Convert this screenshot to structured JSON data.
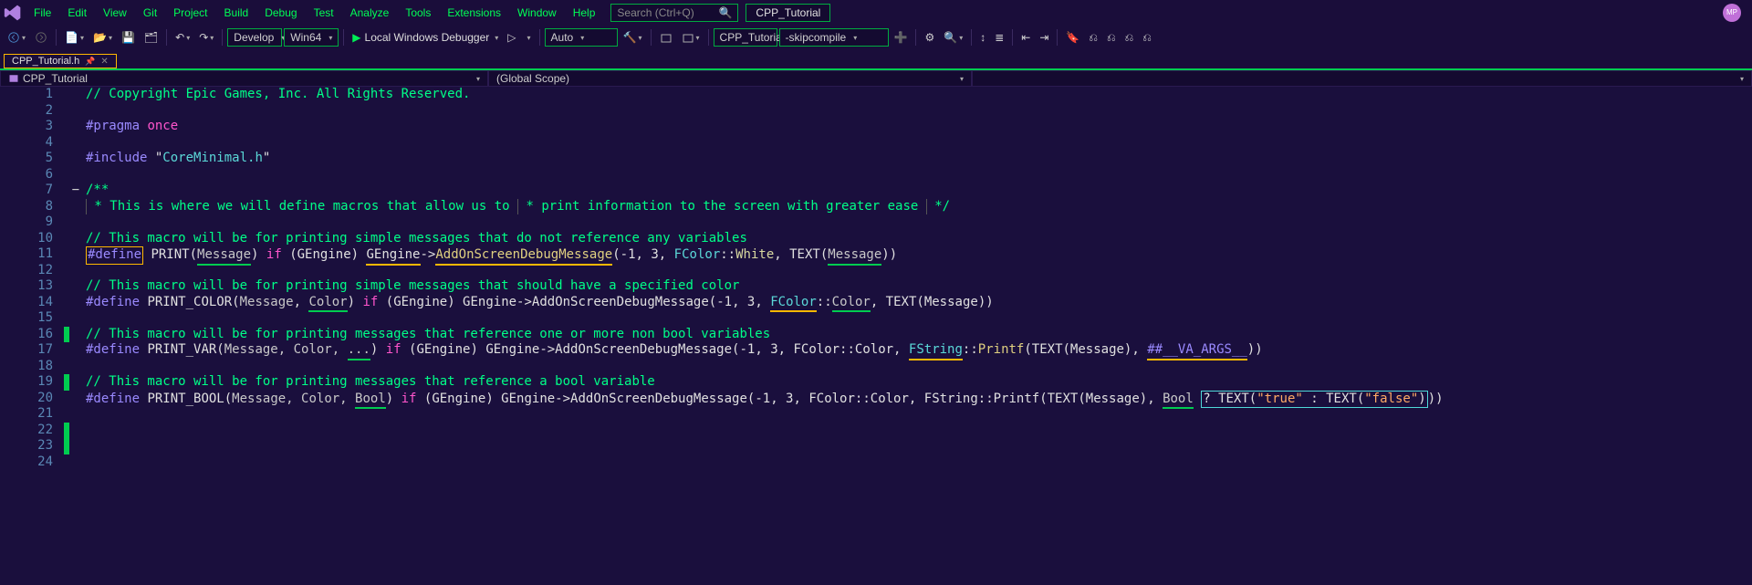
{
  "menu": {
    "items": [
      "File",
      "Edit",
      "View",
      "Git",
      "Project",
      "Build",
      "Debug",
      "Test",
      "Analyze",
      "Tools",
      "Extensions",
      "Window",
      "Help"
    ]
  },
  "search": {
    "placeholder": "Search (Ctrl+Q)"
  },
  "title": "CPP_Tutorial",
  "avatar": "MP",
  "toolbar": {
    "config": "Develop",
    "platform": "Win64",
    "debugger_label": "Local Windows Debugger",
    "run_mode": "Auto",
    "solution": "CPP_Tutorial",
    "skip": "-skipcompile"
  },
  "file_tab": {
    "name": "CPP_Tutorial.h"
  },
  "nav": {
    "project": "CPP_Tutorial",
    "scope": "(Global Scope)"
  },
  "code": {
    "l1_a": "// Copyright Epic Games, Inc. All Rights Reserved.",
    "l3_a": "#pragma",
    "l3_b": " once",
    "l5_a": "#include",
    "l5_b": " \"",
    "l5_c": "CoreMinimal.h",
    "l5_d": "\"",
    "l7_a": "/**",
    "l8_a": " * This is where we will define macros that allow us to",
    "l9_a": " * print information to the screen with greater ease",
    "l10_a": " */",
    "l12_a": "// This macro will be for printing simple messages that do not reference any variables",
    "l13_def": "#define",
    "l13_name": " PRINT(",
    "l13_msg": "Message",
    "l13_a": ") ",
    "l13_if": "if",
    "l13_b": " (GEngine) ",
    "l13_ge": "GEngine",
    "l13_arrow": "->",
    "l13_add": "AddOnScreenDebugMessage",
    "l13_c": "(-1, 3, ",
    "l13_fc": "FColor",
    "l13_cc": "::",
    "l13_wh": "White",
    "l13_d": ", TEXT(",
    "l13_msg2": "Message",
    "l13_e": "))",
    "l15_a": "// This macro will be for printing simple messages that should have a specified color",
    "l16_def": "#define",
    "l16_name": " PRINT_COLOR(",
    "l16_p1": "Message",
    "l16_s1": ", ",
    "l16_p2": "Color",
    "l16_a": ") ",
    "l16_if": "if",
    "l16_b": " (GEngine) GEngine->AddOnScreenDebugMessage(-1, 3, ",
    "l16_fc": "FColor",
    "l16_cc": "::",
    "l16_col": "Color",
    "l16_c": ", TEXT(Message))",
    "l18_a": "// This macro will be for printing messages that reference one or more non bool variables",
    "l19_def": "#define",
    "l19_name": " PRINT_VAR(",
    "l19_p": "Message, Color, ",
    "l19_dots": "...",
    "l19_a": ") ",
    "l19_if": "if",
    "l19_b": " (GEngine) GEngine->AddOnScreenDebugMessage(-1, 3, FColor::Color, ",
    "l19_fs": "FString",
    "l19_cc": "::",
    "l19_pf": "Printf",
    "l19_c": "(TEXT(Message), ",
    "l19_va": "##__VA_ARGS__",
    "l19_d": "))",
    "l21_a": "// This macro will be for printing messages that reference a bool variable",
    "l22_def": "#define",
    "l22_name": " PRINT_BOOL(",
    "l22_p": "Message, Color, ",
    "l22_bool": "Bool",
    "l22_a": ") ",
    "l22_if": "if",
    "l22_b": " (GEngine) GEngine->AddOnScreenDebugMessage(-1, 3, FColor::Color, FString::Printf(TEXT(Message), ",
    "l22_bool2": "Bool",
    "l22_sp": " ",
    "l22_tern_a": "? TEXT(",
    "l22_true": "\"true\"",
    "l22_tern_b": " : TEXT(",
    "l22_false": "\"false\"",
    "l22_tern_c": ")",
    "l22_end": "))"
  },
  "lines": [
    "1",
    "2",
    "3",
    "4",
    "5",
    "6",
    "7",
    "8",
    "9",
    "10",
    "11",
    "12",
    "13",
    "14",
    "15",
    "16",
    "17",
    "18",
    "19",
    "20",
    "21",
    "22",
    "23",
    "24"
  ]
}
